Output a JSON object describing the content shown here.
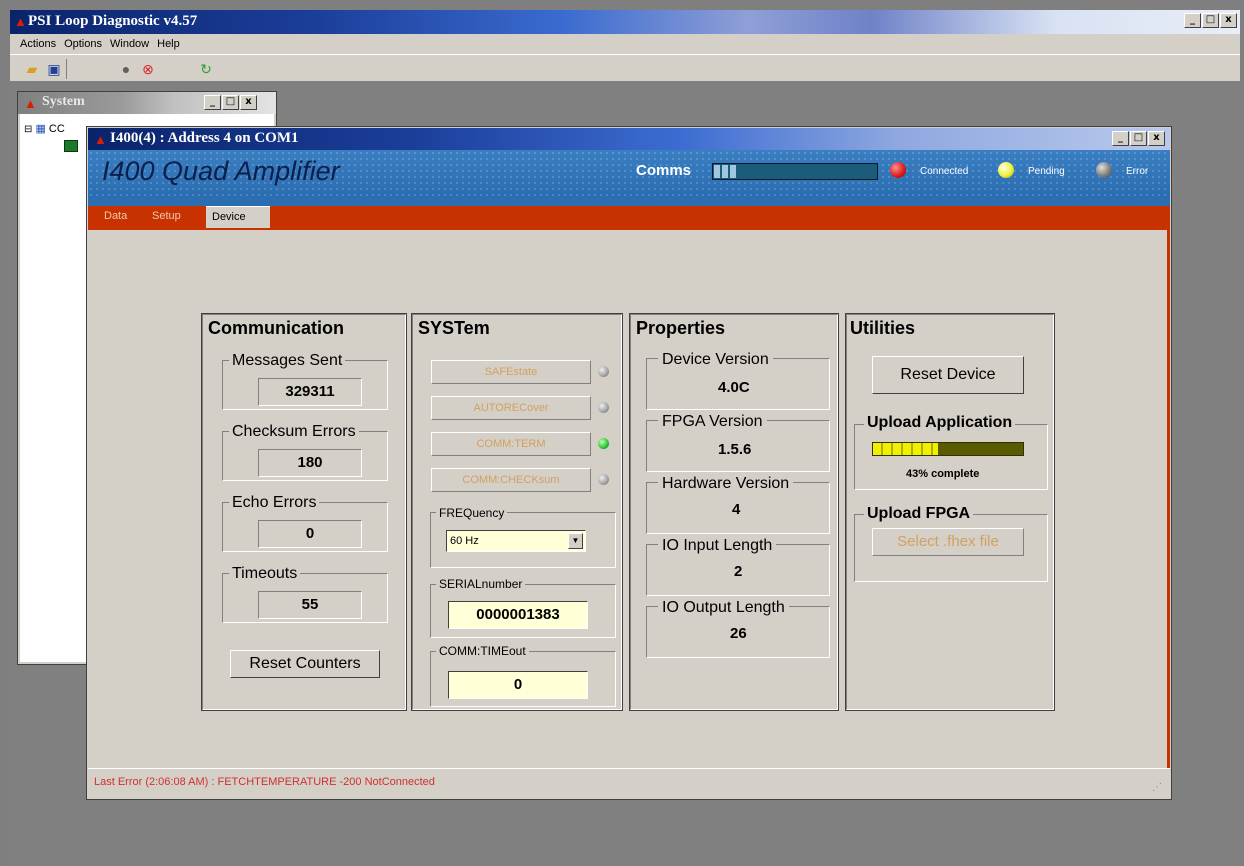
{
  "app": {
    "title": "PSI Loop Diagnostic v4.57",
    "menu": [
      "Actions",
      "Options",
      "Window",
      "Help"
    ],
    "window_buttons": [
      "_",
      "□",
      "x"
    ]
  },
  "toolbar": {
    "icons": [
      "open-folder-icon",
      "save-icon",
      "stop-icon",
      "cancel-icon",
      "refresh-icon"
    ]
  },
  "system_window": {
    "title": "System",
    "tree_node": "CC"
  },
  "device_window": {
    "title": "I400(4) : Address 4 on COM1",
    "heading": "I400 Quad Amplifier",
    "comms": {
      "label": "Comms",
      "progress": 0.15,
      "indicators": [
        {
          "label": "Connected",
          "color": "#e02020"
        },
        {
          "label": "Pending",
          "color": "#f0f040"
        },
        {
          "label": "Error",
          "color": "#808080"
        }
      ]
    },
    "tabs": [
      "Data",
      "Setup",
      "Device"
    ],
    "active_tab": "Device",
    "status": "Last Error (2:06:08 AM) : FETCHTEMPERATURE -200 NotConnected"
  },
  "communication": {
    "title": "Communication",
    "messages_sent_label": "Messages Sent",
    "messages_sent": "329311",
    "checksum_errors_label": "Checksum Errors",
    "checksum_errors": "180",
    "echo_errors_label": "Echo Errors",
    "echo_errors": "0",
    "timeouts_label": "Timeouts",
    "timeouts": "55",
    "reset_button": "Reset Counters"
  },
  "system": {
    "title": "SYSTem",
    "buttons": [
      {
        "label": "SAFEstate",
        "led": "#a0a0a0"
      },
      {
        "label": "AUTORECover",
        "led": "#a0a0a0"
      },
      {
        "label": "COMM:TERM",
        "led": "#30c030"
      },
      {
        "label": "COMM:CHECKsum",
        "led": "#a0a0a0"
      }
    ],
    "frequency_label": "FREQuency",
    "frequency_value": "60 Hz",
    "serial_label": "SERIALnumber",
    "serial_value": "0000001383",
    "timeout_label": "COMM:TIMEout",
    "timeout_value": "0"
  },
  "properties": {
    "title": "Properties",
    "device_version_label": "Device Version",
    "device_version": "4.0C",
    "fpga_version_label": "FPGA Version",
    "fpga_version": "1.5.6",
    "hardware_version_label": "Hardware Version",
    "hardware_version": "4",
    "io_input_label": "IO Input Length",
    "io_input": "2",
    "io_output_label": "IO Output Length",
    "io_output": "26"
  },
  "utilities": {
    "title": "Utilities",
    "reset_device": "Reset Device",
    "upload_app_label": "Upload Application",
    "upload_progress": 0.43,
    "upload_progress_text": "43% complete",
    "upload_fpga_label": "Upload FPGA",
    "select_file": "Select .fhex file"
  },
  "colors": {
    "title_blue": "#0a246a",
    "banner_blue": "#2a6db0",
    "tab_red": "#c83200",
    "error_text": "#d03030"
  }
}
